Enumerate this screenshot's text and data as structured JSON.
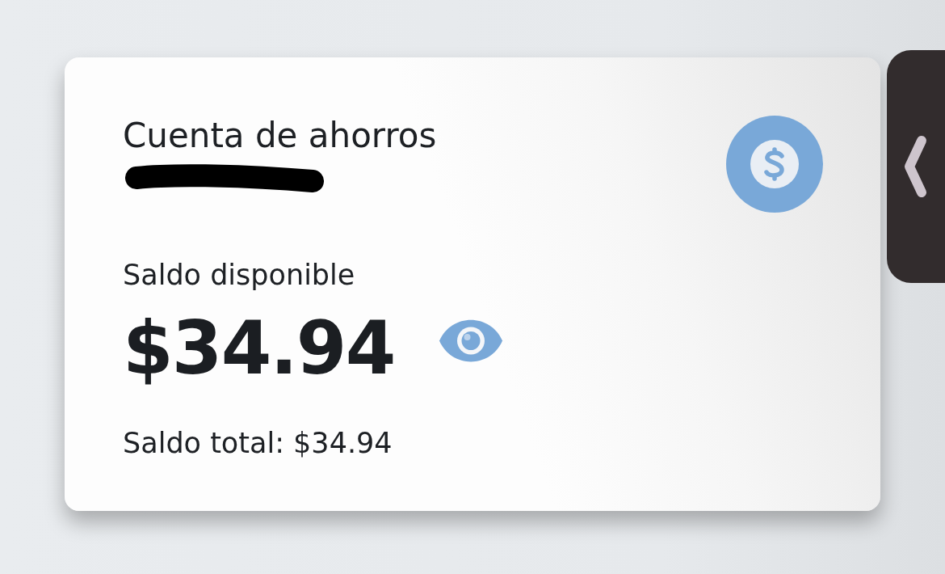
{
  "card": {
    "title": "Cuenta de ahorros",
    "balance_label": "Saldo disponible",
    "balance": "$34.94",
    "total": "Saldo total: $34.94"
  }
}
